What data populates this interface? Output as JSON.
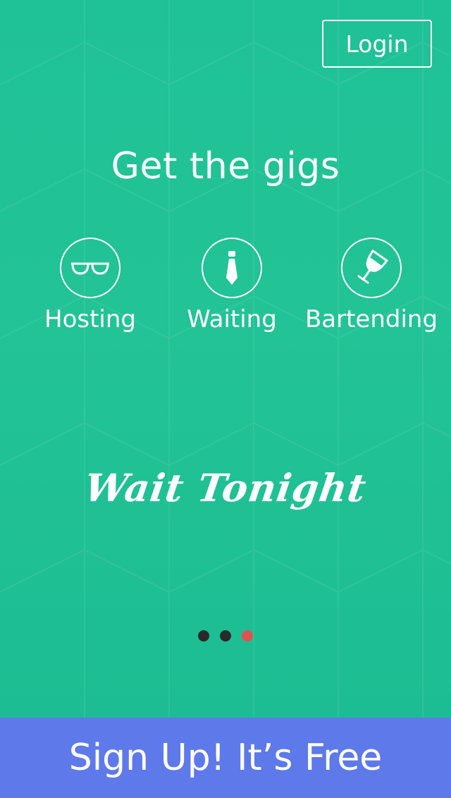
{
  "header": {
    "login_label": "Login"
  },
  "main": {
    "headline": "Get the gigs",
    "gigs": [
      {
        "label": "Hosting",
        "icon": "glasses-icon"
      },
      {
        "label": "Waiting",
        "icon": "tie-icon"
      },
      {
        "label": "Bartending",
        "icon": "wine-glass-icon"
      }
    ],
    "tagline": "Wait Tonight",
    "carousel": {
      "total_pages": 3,
      "active_page": 3
    }
  },
  "footer": {
    "signup_label": "Sign Up! It’s Free"
  },
  "colors": {
    "background": "#20c196",
    "signup_bar": "#5e79ea",
    "dot_inactive": "#2a2a2a",
    "dot_active": "#e0524f",
    "text": "#ffffff"
  }
}
